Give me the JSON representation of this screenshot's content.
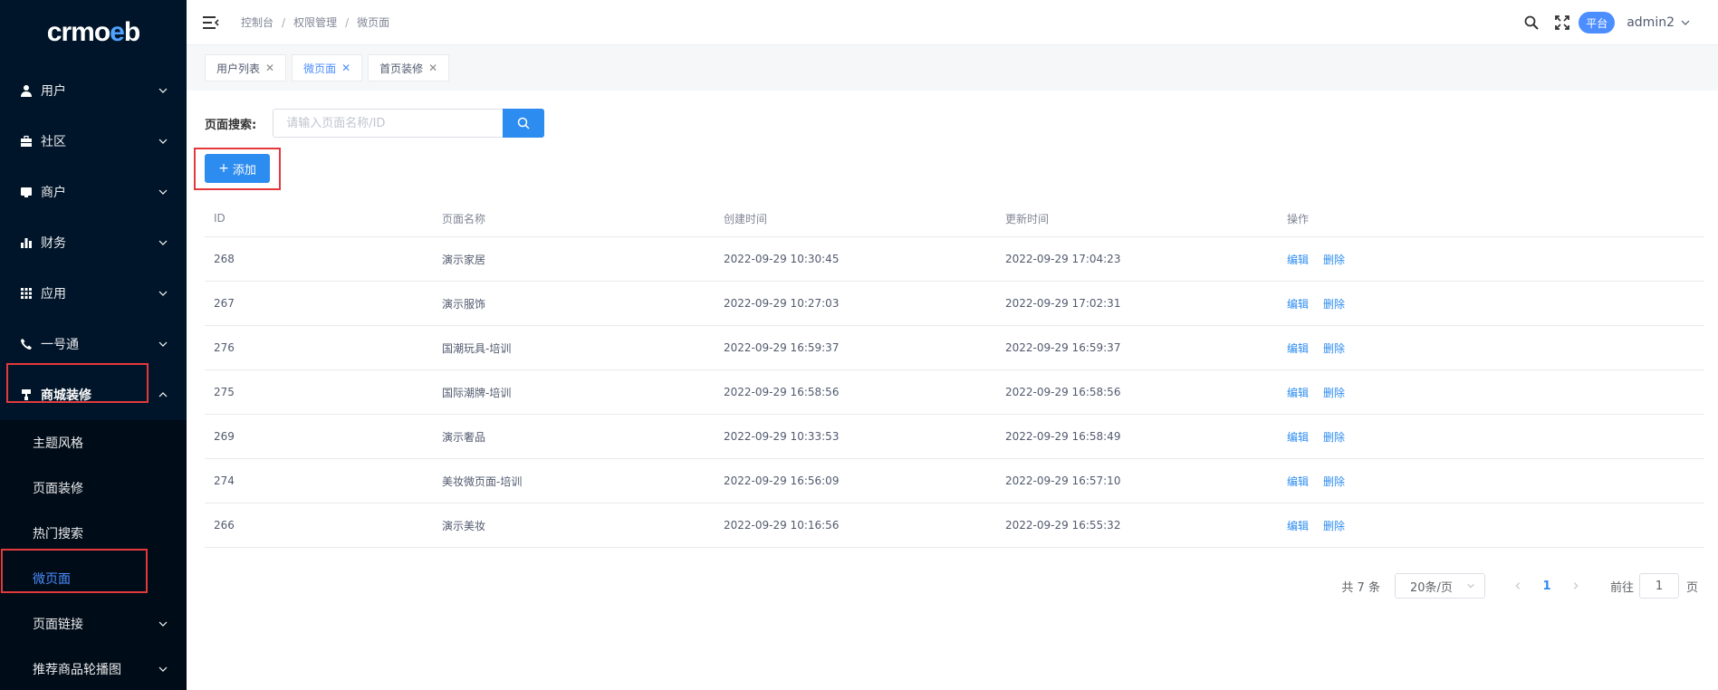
{
  "logo": {
    "text_a": "crm",
    "text_o": "o",
    "text_e": "e",
    "text_b": "b"
  },
  "sidebar": {
    "items": [
      {
        "label": "用户",
        "icon": "user-icon"
      },
      {
        "label": "社区",
        "icon": "briefcase-icon"
      },
      {
        "label": "商户",
        "icon": "shop-icon"
      },
      {
        "label": "财务",
        "icon": "bar-chart-icon"
      },
      {
        "label": "应用",
        "icon": "grid-icon"
      },
      {
        "label": "一号通",
        "icon": "phone-icon"
      },
      {
        "label": "商城装修",
        "icon": "paint-roller-icon"
      }
    ],
    "subitems": [
      {
        "label": "主题风格"
      },
      {
        "label": "页面装修"
      },
      {
        "label": "热门搜索"
      },
      {
        "label": "微页面"
      },
      {
        "label": "页面链接"
      },
      {
        "label": "推荐商品轮播图"
      }
    ]
  },
  "breadcrumb": [
    "控制台",
    "权限管理",
    "微页面"
  ],
  "header": {
    "badge": "平台",
    "user": "admin2"
  },
  "tabs": [
    {
      "label": "用户列表"
    },
    {
      "label": "微页面"
    },
    {
      "label": "首页装修"
    }
  ],
  "search": {
    "label": "页面搜索:",
    "placeholder": "请输入页面名称/ID",
    "value": ""
  },
  "add_button": {
    "label": "添加"
  },
  "table": {
    "headers": [
      "ID",
      "页面名称",
      "创建时间",
      "更新时间",
      "操作"
    ],
    "rows": [
      {
        "id": "268",
        "name": "演示家居",
        "created": "2022-09-29 10:30:45",
        "updated": "2022-09-29 17:04:23"
      },
      {
        "id": "267",
        "name": "演示服饰",
        "created": "2022-09-29 10:27:03",
        "updated": "2022-09-29 17:02:31"
      },
      {
        "id": "276",
        "name": "国潮玩具-培训",
        "created": "2022-09-29 16:59:37",
        "updated": "2022-09-29 16:59:37"
      },
      {
        "id": "275",
        "name": "国际潮牌-培训",
        "created": "2022-09-29 16:58:56",
        "updated": "2022-09-29 16:58:56"
      },
      {
        "id": "269",
        "name": "演示奢品",
        "created": "2022-09-29 10:33:53",
        "updated": "2022-09-29 16:58:49"
      },
      {
        "id": "274",
        "name": "美妆微页面-培训",
        "created": "2022-09-29 16:56:09",
        "updated": "2022-09-29 16:57:10"
      },
      {
        "id": "266",
        "name": "演示美妆",
        "created": "2022-09-29 10:16:56",
        "updated": "2022-09-29 16:55:32"
      }
    ],
    "edit_label": "编辑",
    "delete_label": "删除"
  },
  "pagination": {
    "total": "共 7 条",
    "page_size": "20条/页",
    "current_page": "1",
    "goto_prefix": "前往",
    "goto_value": "1",
    "goto_suffix": "页"
  },
  "colors": {
    "sidebar_bg": "#001529",
    "accent": "#2d8cf0",
    "highlight_border": "#e3393c"
  }
}
